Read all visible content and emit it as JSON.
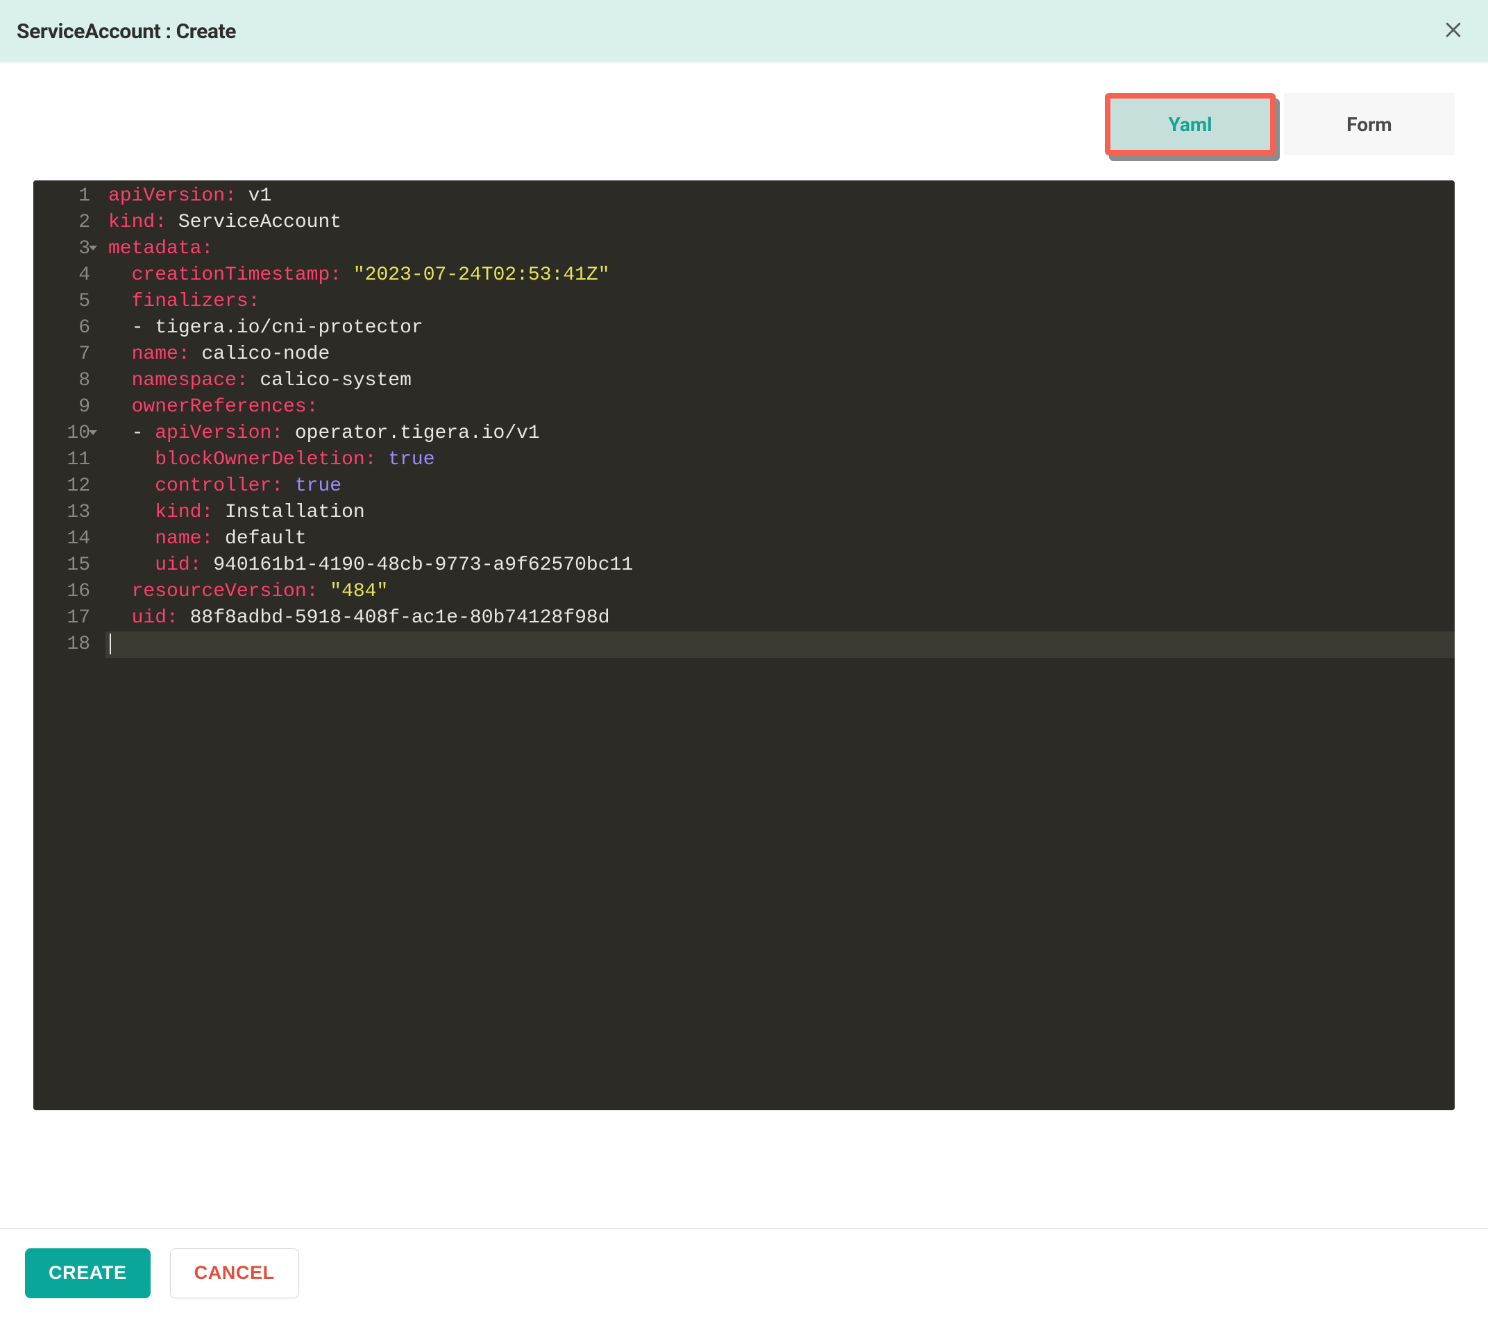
{
  "header": {
    "title": "ServiceAccount : Create"
  },
  "tabs": {
    "yaml": "Yaml",
    "form": "Form",
    "active": "yaml"
  },
  "editor": {
    "line_numbers": [
      "1",
      "2",
      "3",
      "4",
      "5",
      "6",
      "7",
      "8",
      "9",
      "10",
      "11",
      "12",
      "13",
      "14",
      "15",
      "16",
      "17",
      "18"
    ],
    "fold_lines": [
      3,
      10
    ],
    "current_line_index": 17,
    "lines": [
      [
        {
          "t": "key",
          "v": "apiVersion:"
        },
        {
          "t": "plain",
          "v": " v1"
        }
      ],
      [
        {
          "t": "key",
          "v": "kind:"
        },
        {
          "t": "plain",
          "v": " ServiceAccount"
        }
      ],
      [
        {
          "t": "key",
          "v": "metadata:"
        }
      ],
      [
        {
          "t": "plain",
          "v": "  "
        },
        {
          "t": "key",
          "v": "creationTimestamp:"
        },
        {
          "t": "plain",
          "v": " "
        },
        {
          "t": "str",
          "v": "\"2023-07-24T02:53:41Z\""
        }
      ],
      [
        {
          "t": "plain",
          "v": "  "
        },
        {
          "t": "key",
          "v": "finalizers:"
        }
      ],
      [
        {
          "t": "plain",
          "v": "  "
        },
        {
          "t": "dash",
          "v": "- "
        },
        {
          "t": "plain",
          "v": "tigera.io/cni-protector"
        }
      ],
      [
        {
          "t": "plain",
          "v": "  "
        },
        {
          "t": "key",
          "v": "name:"
        },
        {
          "t": "plain",
          "v": " calico-node"
        }
      ],
      [
        {
          "t": "plain",
          "v": "  "
        },
        {
          "t": "key",
          "v": "namespace:"
        },
        {
          "t": "plain",
          "v": " calico-system"
        }
      ],
      [
        {
          "t": "plain",
          "v": "  "
        },
        {
          "t": "key",
          "v": "ownerReferences:"
        }
      ],
      [
        {
          "t": "plain",
          "v": "  "
        },
        {
          "t": "dash",
          "v": "- "
        },
        {
          "t": "key",
          "v": "apiVersion:"
        },
        {
          "t": "plain",
          "v": " operator.tigera.io/v1"
        }
      ],
      [
        {
          "t": "plain",
          "v": "    "
        },
        {
          "t": "key",
          "v": "blockOwnerDeletion:"
        },
        {
          "t": "plain",
          "v": " "
        },
        {
          "t": "bool",
          "v": "true"
        }
      ],
      [
        {
          "t": "plain",
          "v": "    "
        },
        {
          "t": "key",
          "v": "controller:"
        },
        {
          "t": "plain",
          "v": " "
        },
        {
          "t": "bool",
          "v": "true"
        }
      ],
      [
        {
          "t": "plain",
          "v": "    "
        },
        {
          "t": "key",
          "v": "kind:"
        },
        {
          "t": "plain",
          "v": " Installation"
        }
      ],
      [
        {
          "t": "plain",
          "v": "    "
        },
        {
          "t": "key",
          "v": "name:"
        },
        {
          "t": "plain",
          "v": " default"
        }
      ],
      [
        {
          "t": "plain",
          "v": "    "
        },
        {
          "t": "key",
          "v": "uid:"
        },
        {
          "t": "plain",
          "v": " 940161b1-4190-48cb-9773-a9f62570bc11"
        }
      ],
      [
        {
          "t": "plain",
          "v": "  "
        },
        {
          "t": "key",
          "v": "resourceVersion:"
        },
        {
          "t": "plain",
          "v": " "
        },
        {
          "t": "str",
          "v": "\"484\""
        }
      ],
      [
        {
          "t": "plain",
          "v": "  "
        },
        {
          "t": "key",
          "v": "uid:"
        },
        {
          "t": "plain",
          "v": " 88f8adbd-5918-408f-ac1e-80b74128f98d"
        }
      ],
      []
    ]
  },
  "footer": {
    "create": "CREATE",
    "cancel": "CANCEL"
  }
}
